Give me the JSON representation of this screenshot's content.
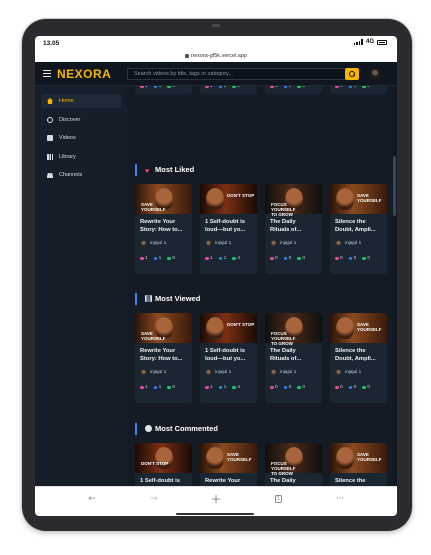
{
  "status": {
    "time": "13.05",
    "network": "4G"
  },
  "browser": {
    "url": "nexora-gf5k.vercel.app"
  },
  "header": {
    "logo": "NEXORA",
    "search_placeholder": "Search videos by title, tags or category...",
    "accent": "#f7b500"
  },
  "sidebar": {
    "items": [
      {
        "label": "Home",
        "icon": "home-icon",
        "active": true
      },
      {
        "label": "Discover",
        "icon": "search-icon",
        "active": false
      },
      {
        "label": "Videos",
        "icon": "video-icon",
        "active": false
      },
      {
        "label": "Library",
        "icon": "library-icon",
        "active": false
      },
      {
        "label": "Channels",
        "icon": "channels-icon",
        "active": false
      }
    ]
  },
  "top_partial": {
    "stats": [
      {
        "likes": "1",
        "views": "1",
        "comments": "4"
      },
      {
        "likes": "1",
        "views": "1",
        "comments": "0"
      },
      {
        "likes": "0",
        "views": "0",
        "comments": "0"
      },
      {
        "likes": "0",
        "views": "0",
        "comments": "0"
      }
    ]
  },
  "sections": [
    {
      "title": "Most Liked",
      "icon": "heart-icon",
      "cards": [
        {
          "title_line1": "Rewrite Your",
          "title_line2": "Story: How to...",
          "channel": "injajul 1",
          "likes": "1",
          "views": "1",
          "comments": "0",
          "thumb_text": "Save Yourself"
        },
        {
          "title_line1": "1 Self-doubt is",
          "title_line2": "loud—but yo...",
          "channel": "injajul 1",
          "likes": "1",
          "views": "1",
          "comments": "4",
          "thumb_text": "DON'T STOP"
        },
        {
          "title_line1": "The Daily",
          "title_line2": "Rituals of...",
          "channel": "injajul 1",
          "likes": "0",
          "views": "0",
          "comments": "0",
          "thumb_text": "Focus Yourself TO GROW"
        },
        {
          "title_line1": "Silence the",
          "title_line2": "Doubt, Ampli...",
          "channel": "injajul 1",
          "likes": "0",
          "views": "0",
          "comments": "0",
          "thumb_text": "Save Yourself"
        }
      ]
    },
    {
      "title": "Most Viewed",
      "icon": "film-icon",
      "cards": [
        {
          "title_line1": "Rewrite Your",
          "title_line2": "Story: How to...",
          "channel": "injajul 1",
          "likes": "1",
          "views": "1",
          "comments": "0",
          "thumb_text": "Save Yourself"
        },
        {
          "title_line1": "1 Self-doubt is",
          "title_line2": "loud—but yo...",
          "channel": "injajul 1",
          "likes": "1",
          "views": "1",
          "comments": "4",
          "thumb_text": "DON'T STOP"
        },
        {
          "title_line1": "The Daily",
          "title_line2": "Rituals of...",
          "channel": "injajul 1",
          "likes": "0",
          "views": "0",
          "comments": "0",
          "thumb_text": "Focus Yourself TO GROW"
        },
        {
          "title_line1": "Silence the",
          "title_line2": "Doubt, Ampli...",
          "channel": "injajul 1",
          "likes": "0",
          "views": "0",
          "comments": "0",
          "thumb_text": "Save Yourself"
        }
      ]
    },
    {
      "title": "Most Commented",
      "icon": "comment-icon",
      "cards": [
        {
          "title_line1": "1 Self-doubt is",
          "title_line2": "loud—but yo...",
          "channel": "injajul 1",
          "likes": "1",
          "views": "1",
          "comments": "4",
          "thumb_text": "DON'T STOP"
        },
        {
          "title_line1": "Rewrite Your",
          "title_line2": "Story: How to...",
          "channel": "injajul 1",
          "likes": "1",
          "views": "1",
          "comments": "0",
          "thumb_text": "Save Yourself"
        },
        {
          "title_line1": "The Daily",
          "title_line2": "Rituals of...",
          "channel": "injajul 1",
          "likes": "0",
          "views": "0",
          "comments": "0",
          "thumb_text": "Focus Yourself TO GROW"
        },
        {
          "title_line1": "Silence the",
          "title_line2": "Doubt, Ampli...",
          "channel": "injajul 1",
          "likes": "0",
          "views": "0",
          "comments": "0",
          "thumb_text": "Save Yourself"
        }
      ]
    }
  ],
  "bottom_nav": {
    "back": "←",
    "forward": "→",
    "new_tab": "+",
    "tabs": "1",
    "more": "···"
  }
}
